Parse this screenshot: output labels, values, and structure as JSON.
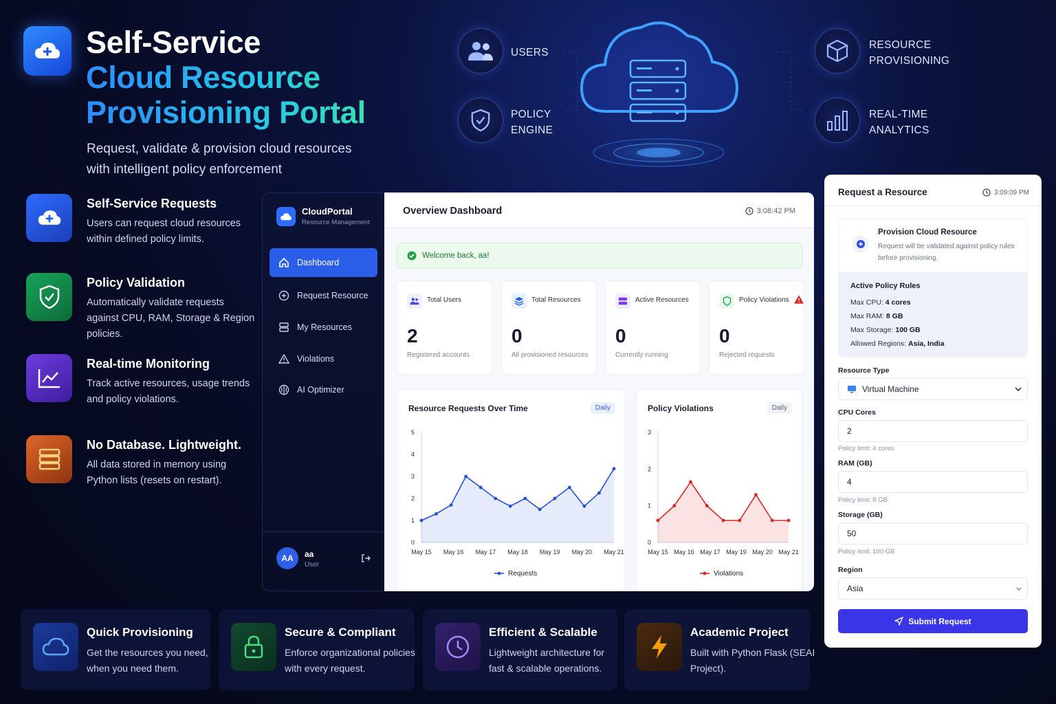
{
  "hero": {
    "title_line1": "Self-Service",
    "title_line2": "Cloud Resource",
    "title_line3": "Provisioning Portal",
    "subtitle": "Request, validate & provision cloud resources with intelligent policy enforcement"
  },
  "diagram": {
    "users": "USERS",
    "policy_engine_1": "POLICY",
    "policy_engine_2": "ENGINE",
    "resource_prov_1": "RESOURCE",
    "resource_prov_2": "PROVISIONING",
    "analytics_1": "REAL-TIME",
    "analytics_2": "ANALYTICS"
  },
  "features": [
    {
      "title": "Self-Service Requests",
      "desc": "Users can request cloud resources within defined policy limits.",
      "icon": "cloud-plus-icon",
      "color": "#1f5ee8"
    },
    {
      "title": "Policy Validation",
      "desc": "Automatically validate requests against CPU, RAM, Storage & Region policies.",
      "icon": "shield-check-icon",
      "color": "#138a4a"
    },
    {
      "title": "Real-time Monitoring",
      "desc": "Track active resources, usage trends and policy violations.",
      "icon": "trend-chart-icon",
      "color": "#5b2fc9"
    },
    {
      "title": "No Database. Lightweight.",
      "desc": "All data stored in memory using Python lists (resets on restart).",
      "icon": "database-icon",
      "color": "#c2531b"
    }
  ],
  "sidebar": {
    "brand": "CloudPortal",
    "brand_sub": "Resource Management",
    "items": [
      {
        "label": "Dashboard",
        "icon": "home-icon"
      },
      {
        "label": "Request Resource",
        "icon": "plus-circle-icon"
      },
      {
        "label": "My Resources",
        "icon": "server-icon"
      },
      {
        "label": "Violations",
        "icon": "warning-icon"
      },
      {
        "label": "AI Optimizer",
        "icon": "brain-icon"
      }
    ],
    "user_initials": "AA",
    "user_name": "aa",
    "user_role": "User"
  },
  "dashboard": {
    "title": "Overview Dashboard",
    "time": "3:08:42 PM",
    "welcome": "Welcome back, aa!",
    "stats": [
      {
        "label": "Total Users",
        "value": "2",
        "sub": "Registered accounts",
        "icon": "users-icon",
        "color": "#4f46e5"
      },
      {
        "label": "Total Resources",
        "value": "0",
        "sub": "All provisioned resources",
        "icon": "layers-icon",
        "color": "#2563eb"
      },
      {
        "label": "Active Resources",
        "value": "0",
        "sub": "Currently running",
        "icon": "server-icon",
        "color": "#7c3aed"
      },
      {
        "label": "Policy Violations",
        "value": "0",
        "sub": "Rejected requests",
        "icon": "shield-icon",
        "color": "#16a34a"
      }
    ]
  },
  "chart_data": [
    {
      "type": "area",
      "title": "Resource Requests Over Time",
      "badge": "Daily",
      "x": [
        "May 15",
        "May 15",
        "May 15",
        "May 16",
        "May 16",
        "May 16",
        "May 17",
        "May 17",
        "May 18",
        "May 18",
        "May 19",
        "May 19",
        "May 20",
        "May 20",
        "May 21"
      ],
      "x_ticks": [
        "May 15",
        "May 16",
        "May 17",
        "May 18",
        "May 19",
        "May 20",
        "May 21"
      ],
      "y_ticks": [
        0,
        1,
        2,
        3,
        4,
        5
      ],
      "ylim": [
        0,
        5
      ],
      "series": [
        {
          "name": "Requests",
          "color": "#2451d6",
          "values": [
            1.0,
            1.3,
            1.7,
            3.0,
            2.5,
            2.0,
            1.65,
            2.0,
            1.5,
            2.0,
            2.5,
            1.65,
            2.25,
            3.35
          ]
        }
      ]
    },
    {
      "type": "area",
      "title": "Policy Violations",
      "badge": "Daily",
      "x_ticks": [
        "May 15",
        "May 16",
        "May 17",
        "May 19",
        "May 20",
        "May 21"
      ],
      "y_ticks": [
        0,
        1,
        2,
        3
      ],
      "ylim": [
        0,
        3
      ],
      "series": [
        {
          "name": "Violations",
          "color": "#dc2626",
          "values": [
            0.6,
            1.0,
            1.65,
            1.0,
            0.6,
            0.6,
            1.3,
            0.6,
            0.6
          ]
        }
      ]
    }
  ],
  "request": {
    "title": "Request a Resource",
    "time": "3:09:09 PM",
    "prov_title": "Provision Cloud Resource",
    "prov_desc": "Request will be validated against policy rules before provisioning.",
    "rules_title": "Active Policy Rules",
    "rules": [
      {
        "label": "Max CPU: ",
        "value": "4 cores"
      },
      {
        "label": "Max RAM: ",
        "value": "8 GB"
      },
      {
        "label": "Max Storage: ",
        "value": "100 GB"
      },
      {
        "label": "Allowed Regions: ",
        "value": "Asia, India"
      }
    ],
    "resource_type_label": "Resource Type",
    "resource_type_value": "Virtual Machine",
    "cpu_label": "CPU Cores",
    "cpu_value": "2",
    "cpu_hint": "Policy limit: 4 cores",
    "ram_label": "RAM (GB)",
    "ram_value": "4",
    "ram_hint": "Policy limit: 8 GB",
    "storage_label": "Storage (GB)",
    "storage_value": "50",
    "storage_hint": "Policy limit: 100 GB",
    "region_label": "Region",
    "region_value": "Asia",
    "submit": "Submit Request"
  },
  "bottom": [
    {
      "title": "Quick Provisioning",
      "desc": "Get the resources you need, when you need them.",
      "icon": "cloud-icon",
      "color": "#3b82f6"
    },
    {
      "title": "Secure & Compliant",
      "desc": "Enforce organizational policies with every request.",
      "icon": "lock-icon",
      "color": "#22c55e"
    },
    {
      "title": "Efficient & Scalable",
      "desc": "Lightweight architecture for fast & scalable operations.",
      "icon": "clock-icon",
      "color": "#8b5cf6"
    },
    {
      "title": "Academic Project",
      "desc": "Built with Python Flask (SEAI Project).",
      "icon": "bolt-icon",
      "color": "#f59e0b"
    }
  ]
}
